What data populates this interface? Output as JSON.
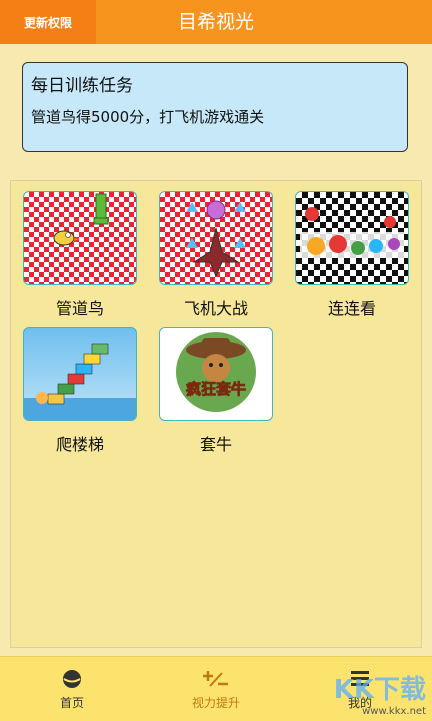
{
  "header": {
    "left_label": "更新权限",
    "title": "目希视光"
  },
  "task": {
    "title": "每日训练任务",
    "description": "管道鸟得5000分，打飞机游戏通关"
  },
  "games": [
    {
      "label": "管道鸟",
      "icon": "flappy-bird-thumb"
    },
    {
      "label": "飞机大战",
      "icon": "plane-war-thumb"
    },
    {
      "label": "连连看",
      "icon": "link-match-thumb"
    },
    {
      "label": "爬楼梯",
      "icon": "stair-climb-thumb"
    },
    {
      "label": "套牛",
      "icon": "lasso-cattle-thumb",
      "art_text": "疯狂套牛"
    }
  ],
  "tabs": [
    {
      "label": "首页",
      "icon": "home-icon"
    },
    {
      "label": "视力提升",
      "icon": "plus-minus-icon",
      "active": true
    },
    {
      "label": "我的",
      "icon": "menu-icon"
    }
  ],
  "watermark": {
    "text": "KK下载",
    "url": "www.kkx.net"
  },
  "colors": {
    "header": "#f7941d",
    "background": "#f7e9b0",
    "task_box": "#c6e8f8",
    "tabbar": "#fbe36e",
    "thumb_border": "#3fb6c0"
  }
}
